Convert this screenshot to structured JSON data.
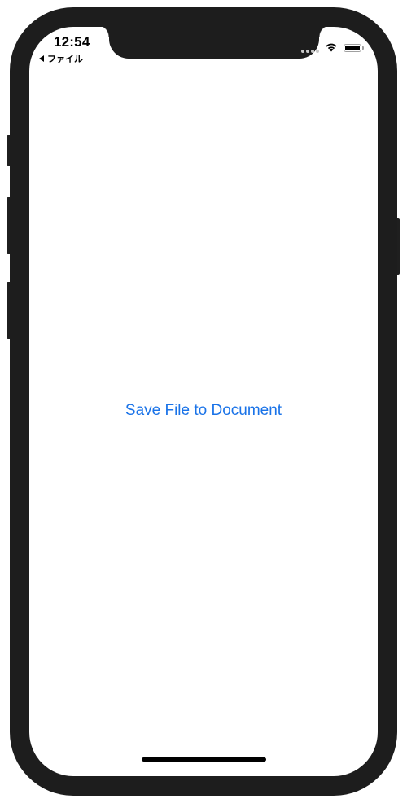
{
  "status_bar": {
    "time": "12:54",
    "back_label": "ファイル",
    "icons": [
      "cellular-signal-icon",
      "wifi-icon",
      "battery-icon"
    ]
  },
  "main": {
    "action_label": "Save File to Document"
  },
  "colors": {
    "accent": "#1a73e8",
    "device_frame": "#1d1d1d"
  }
}
